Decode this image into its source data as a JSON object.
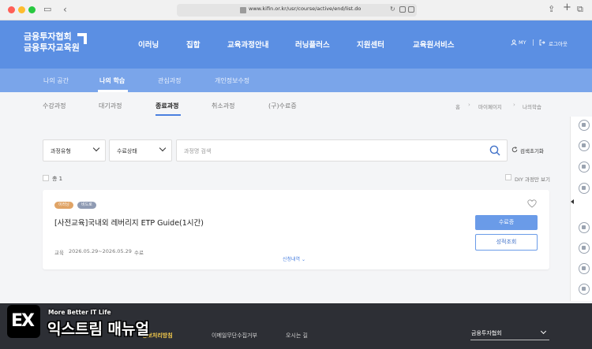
{
  "browser": {
    "url": "www.kifin.or.kr/usr/course/active/end/list.do"
  },
  "header": {
    "logo_line1": "금융투자협회",
    "logo_line2": "금융투자교육원",
    "nav": [
      "이러닝",
      "집합",
      "교육과정안내",
      "러닝플러스",
      "지원센터",
      "교육원서비스"
    ],
    "my_label": "MY",
    "logout_label": "로그아웃"
  },
  "subnav": {
    "items": [
      "나의 공간",
      "나의 학습",
      "관심과정",
      "개인정보수정"
    ],
    "active": "나의 학습"
  },
  "tabs": {
    "items": [
      "수강과정",
      "대기과정",
      "종료과정",
      "취소과정",
      "(구)수료증"
    ],
    "active": "종료과정"
  },
  "breadcrumb": [
    "홈",
    "마이페이지",
    "나의학습"
  ],
  "filters": {
    "course_type": "과정유형",
    "completion_status": "수료상태",
    "search_placeholder": "과정명 검색",
    "reset_label": "검색초기화"
  },
  "list": {
    "total_label": "총 1",
    "diy_label": "DIY 과정만 보기"
  },
  "course": {
    "badges": [
      "이러닝",
      "비드로"
    ],
    "title": "[사전교육]국내외 레버리지 ETP Guide(1시간)",
    "period_label": "교육",
    "period": "2026.05.29~2026.05.29",
    "status": "수료",
    "more_label": "신청내역",
    "certificate_button": "수료증",
    "grade_button": "성적조회"
  },
  "footer": {
    "links": [
      "정보처리방침",
      "이메일무단수집거부",
      "오시는 길"
    ],
    "highlight_link": "정보처리방침",
    "org_select": "금융투자협회"
  },
  "watermark": {
    "logo": "EX",
    "tagline": "More Better IT Life",
    "name": "익스트림 매뉴얼"
  },
  "colors": {
    "brand_blue": "#5b8fe3",
    "subnav_blue": "#7aa5ea",
    "button_blue": "#6a9be8",
    "footer_bg": "#2d2f35",
    "footer_highlight": "#f2c94c"
  }
}
